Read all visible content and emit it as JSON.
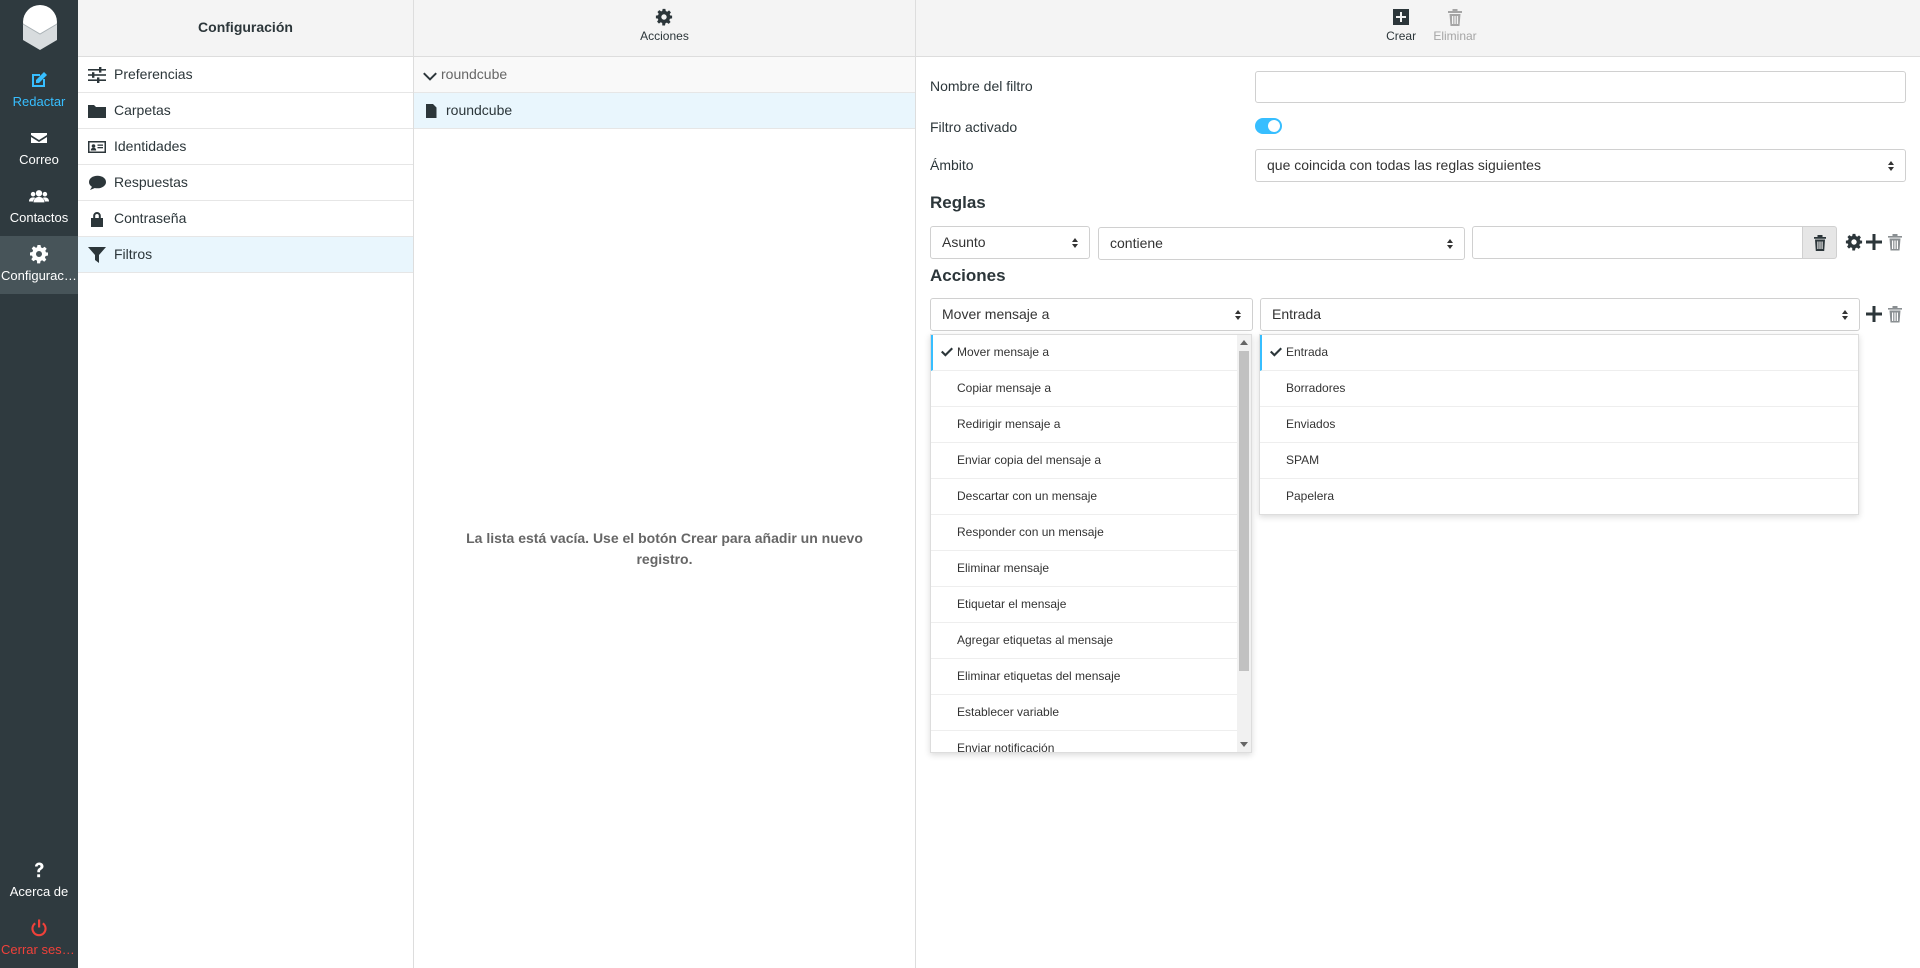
{
  "nav": {
    "compose": "Redactar",
    "mail": "Correo",
    "contacts": "Contactos",
    "settings": "Configuraci...",
    "about": "Acerca de",
    "logout": "Cerrar sesión"
  },
  "settings_column": {
    "title": "Configuración",
    "items": [
      {
        "label": "Preferencias",
        "icon": "sliders-icon"
      },
      {
        "label": "Carpetas",
        "icon": "folder-icon"
      },
      {
        "label": "Identidades",
        "icon": "id-card-icon"
      },
      {
        "label": "Respuestas",
        "icon": "comment-icon"
      },
      {
        "label": "Contraseña",
        "icon": "lock-icon"
      },
      {
        "label": "Filtros",
        "icon": "filter-icon",
        "selected": true
      }
    ]
  },
  "filtersets_column": {
    "actions_label": "Acciones",
    "group": "roundcube",
    "item": "roundcube",
    "empty_message": "La lista está vacía. Use el botón Crear para añadir un nuevo registro."
  },
  "form_toolbar": {
    "create": "Crear",
    "delete": "Eliminar"
  },
  "form": {
    "name_label": "Nombre del filtro",
    "name_value": "",
    "enabled_label": "Filtro activado",
    "enabled": true,
    "scope_label": "Ámbito",
    "scope_value": "que coincida con todas las reglas siguientes",
    "rules_heading": "Reglas",
    "rule_header": "Asunto",
    "rule_operator": "contiene",
    "rule_value": "",
    "actions_heading": "Acciones",
    "action_type": "Mover mensaje a",
    "action_target": "Entrada"
  },
  "action_type_options": [
    "Mover mensaje a",
    "Copiar mensaje a",
    "Redirigir mensaje a",
    "Enviar copia del mensaje a",
    "Descartar con un mensaje",
    "Responder con un mensaje",
    "Eliminar mensaje",
    "Etiquetar el mensaje",
    "Agregar etiquetas al mensaje",
    "Eliminar etiquetas del mensaje",
    "Establecer variable",
    "Enviar notificación"
  ],
  "folder_options": [
    "Entrada",
    "Borradores",
    "Enviados",
    "SPAM",
    "Papelera"
  ],
  "colors": {
    "accent": "#37beff",
    "sidebar": "#2f3a3f",
    "danger": "#f0413a"
  }
}
